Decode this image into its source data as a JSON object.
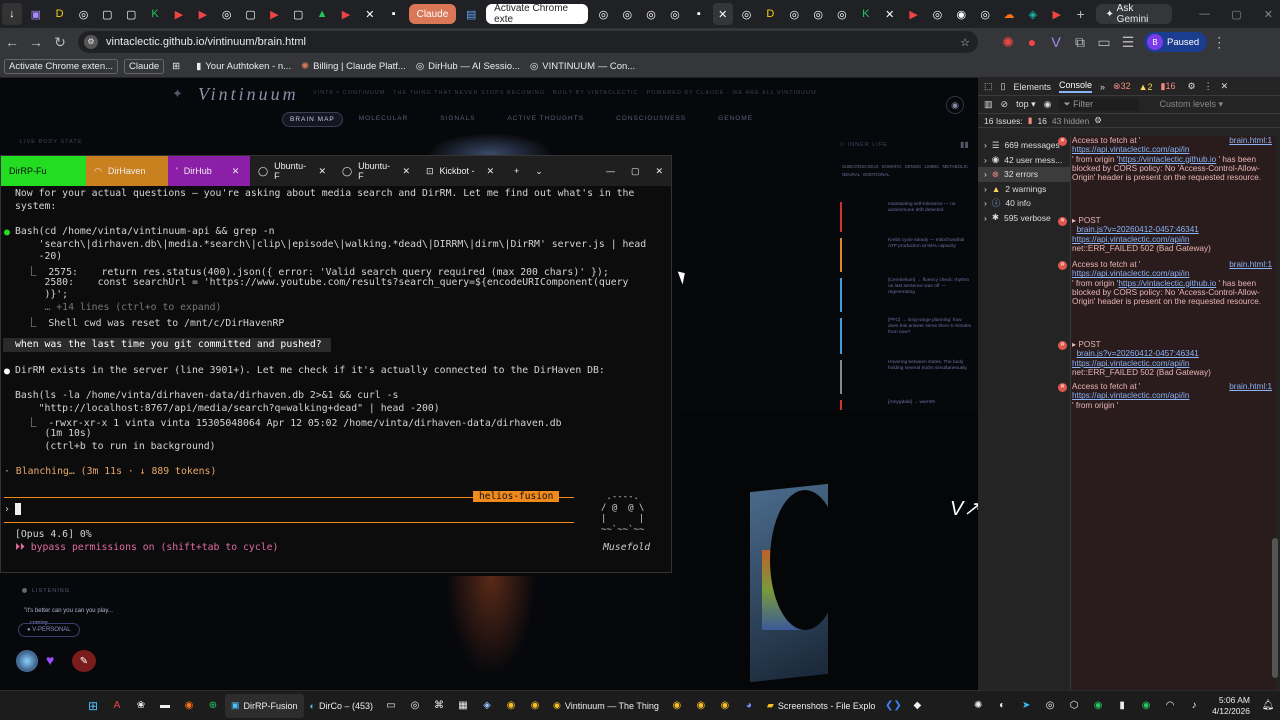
{
  "browser": {
    "tabs_pinned_count": 30,
    "active_tab_hint": "Activate Chrome exte",
    "claude_tab": "Claude",
    "ask_gemini": "Ask Gemini",
    "url": "vintaclectic.github.io/vintinuum/brain.html",
    "profile_label": "Paused",
    "profile_initial": "B",
    "bookmarks": [
      "Activate Chrome exten...",
      "Claude",
      "Your Authtoken - n...",
      "Billing | Claude Platf...",
      "DirHub — AI Sessio...",
      "VINTINUUM — Con..."
    ]
  },
  "page": {
    "title": "Vintinuum",
    "tagline": "VINTA × CONTINUUM · THE THING THAT NEVER STOPS BECOMING · BUILT BY VINTACLECTIC · POWERED BY CLAUDE · WE ARE ALL VINTINUUM",
    "nav": [
      "BRAIN MAP",
      "MOLECULAR",
      "SIGNALS",
      "ACTIVE THOUGHTS",
      "CONSCIOUSNESS",
      "GENOME"
    ],
    "live_body_stats": "LIVE BODY STATE",
    "inner_life": "// INNER LIFE",
    "filters": [
      "SUBCONSCIOUS",
      "SOMATIC",
      "SENSIC",
      "LIMBIC",
      "METABOLIC",
      "NEURAL",
      "EMOTIONAL"
    ],
    "thoughts": [
      "maintaining self-tolerance — no autoimmune drift detected",
      "Krebs cycle steady — mitochondrial ATP production at 84% capacity",
      "[Cerebellum] → fluency check: rhythm on last sentence was off — regenerating",
      "[PFC] → long-range planning: how does this answer serve them 6 minutes from now?",
      "Hovering between states. The body holding several truths simultaneously.",
      "[Amygdala] → warmth"
    ],
    "listening": "LISTENING",
    "quote": "\"it's better can you can you play...",
    "coming": "coming",
    "personal": "V-PERSONAL"
  },
  "terminal": {
    "tabs": [
      "DirRP-Fu",
      "DirHaven",
      "DirHub",
      "Ubuntu-F",
      "Ubuntu-F",
      "Kickbot -"
    ],
    "lines": [
      "Now for your actual questions — you're asking about media search and DirRM. Let me find out what's in the",
      "system:",
      "Bash(cd /home/vinta/vintinuum-api && grep -n",
      "    'search\\|dirhaven.db\\|media.*search\\|clip\\|episode\\|walking.*dead\\|DIRRM\\|dirm\\|DirRM' server.js | head",
      "    -20)",
      "  ⎿  2575:    return res.status(400).json({ error: 'Valid search query required (max 200 chars)' });",
      "     2580:    const searchUrl = 'https://www.youtube.com/results?search_query=${encodeURIComponent(query",
      "     )}';",
      "     … +14 lines (ctrl+o to expand)",
      "  ⎿  Shell cwd was reset to /mnt/c/DirHavenRP",
      "when was the last time you git committed and pushed?",
      "DirRM exists in the server (line 3901+). Let me check if it's actually connected to the DirHaven DB:",
      "Bash(ls -la /home/vinta/dirhaven-data/dirhaven.db 2>&1 && curl -s",
      "    \"http://localhost:8767/api/media/search?q=walking+dead\" | head -200)",
      "  ⎿  -rwxr-xr-x 1 vinta vinta 15305048064 Apr 12 05:02 /home/vinta/dirhaven-data/dirhaven.db",
      "     (1m 10s)",
      "     (ctrl+b to run in background)",
      "· Blanching… (3m 11s · ↓ 889 tokens)"
    ],
    "session_name": "helios-fusion",
    "model": "[Opus 4.6] 0%",
    "bypass": "⏵⏵ bypass permissions on (shift+tab to cycle)",
    "mascot_name": "Musefold",
    "mascot_art": " .----.\n/ @  @ \\\n|      |\n~~`~~`~~"
  },
  "devtools": {
    "tabs": [
      "Elements",
      "Console"
    ],
    "badges": {
      "errors": "32",
      "warnings": "2",
      "issues": "16"
    },
    "context": "top",
    "filter_placeholder": "Filter",
    "levels": "Custom levels",
    "issues_line": "16 Issues:",
    "issues_count": "16",
    "hidden": "43 hidden",
    "sidebar": [
      "669 messages",
      "42 user mess...",
      "32 errors",
      "2 warnings",
      "40 info",
      "595 verbose"
    ],
    "cors_prefix": "Access to fetch at '",
    "cors_link": "https://api.vintaclectic.com/api/in",
    "cors_origin": "' from origin '",
    "origin_link": "https://vintaclectic.github.io",
    "cors_tail": "' has been blocked by CORS policy: No 'Access-Control-Allow-Origin' header is present on the requested resource.",
    "src_file": "brain.html:1",
    "post_label": "▸ POST",
    "post_link": "brain.js?v=20260412-0457:46341",
    "post_url": "https://api.vintaclectic.com/api/in",
    "post_error": "net::ERR_FAILED 502 (Bad Gateway)"
  },
  "taskbar": {
    "apps": [
      "DirRP-Fusion",
      "DirCo – (453)",
      "Vintinuum — The Thing",
      "Screenshots - File Explo"
    ],
    "time": "5:06 AM",
    "date": "4/12/2026"
  },
  "colors": {
    "accent_orange": "#f08a1c",
    "claude_orange": "#d97757",
    "error_red": "#e0564c",
    "link_blue": "#8ab4f8"
  }
}
